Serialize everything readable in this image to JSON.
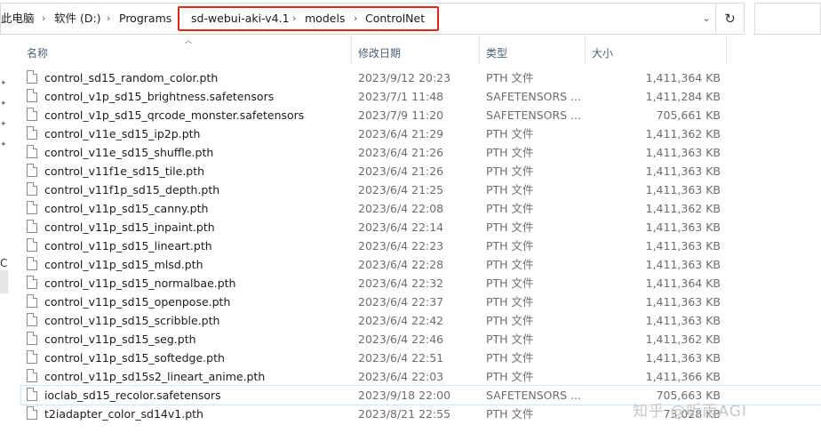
{
  "address_bar": {
    "crumbs": [
      "此电脑",
      "软件 (D:)",
      "Programs",
      "sd-webui-aki-v4.1",
      "models",
      "ControlNet"
    ]
  },
  "nav": {
    "partial_label": "C"
  },
  "columns": {
    "name": "名称",
    "modified": "修改日期",
    "type": "类型",
    "size": "大小"
  },
  "files": [
    {
      "name": "control_sd15_random_color.pth",
      "modified": "2023/9/12 20:23",
      "type": "PTH 文件",
      "size": "1,411,364 KB"
    },
    {
      "name": "control_v1p_sd15_brightness.safetensors",
      "modified": "2023/7/1 11:48",
      "type": "SAFETENSORS ...",
      "size": "1,411,284 KB"
    },
    {
      "name": "control_v1p_sd15_qrcode_monster.safetensors",
      "modified": "2023/7/9 11:20",
      "type": "SAFETENSORS ...",
      "size": "705,661 KB"
    },
    {
      "name": "control_v11e_sd15_ip2p.pth",
      "modified": "2023/6/4 21:29",
      "type": "PTH 文件",
      "size": "1,411,362 KB"
    },
    {
      "name": "control_v11e_sd15_shuffle.pth",
      "modified": "2023/6/4 21:26",
      "type": "PTH 文件",
      "size": "1,411,363 KB"
    },
    {
      "name": "control_v11f1e_sd15_tile.pth",
      "modified": "2023/6/4 21:26",
      "type": "PTH 文件",
      "size": "1,411,363 KB"
    },
    {
      "name": "control_v11f1p_sd15_depth.pth",
      "modified": "2023/6/4 21:25",
      "type": "PTH 文件",
      "size": "1,411,363 KB"
    },
    {
      "name": "control_v11p_sd15_canny.pth",
      "modified": "2023/6/4 22:08",
      "type": "PTH 文件",
      "size": "1,411,362 KB"
    },
    {
      "name": "control_v11p_sd15_inpaint.pth",
      "modified": "2023/6/4 22:14",
      "type": "PTH 文件",
      "size": "1,411,363 KB"
    },
    {
      "name": "control_v11p_sd15_lineart.pth",
      "modified": "2023/6/4 22:23",
      "type": "PTH 文件",
      "size": "1,411,363 KB"
    },
    {
      "name": "control_v11p_sd15_mlsd.pth",
      "modified": "2023/6/4 22:28",
      "type": "PTH 文件",
      "size": "1,411,363 KB"
    },
    {
      "name": "control_v11p_sd15_normalbae.pth",
      "modified": "2023/6/4 22:32",
      "type": "PTH 文件",
      "size": "1,411,364 KB"
    },
    {
      "name": "control_v11p_sd15_openpose.pth",
      "modified": "2023/6/4 22:37",
      "type": "PTH 文件",
      "size": "1,411,363 KB"
    },
    {
      "name": "control_v11p_sd15_scribble.pth",
      "modified": "2023/6/4 22:42",
      "type": "PTH 文件",
      "size": "1,411,363 KB"
    },
    {
      "name": "control_v11p_sd15_seg.pth",
      "modified": "2023/6/4 22:46",
      "type": "PTH 文件",
      "size": "1,411,362 KB"
    },
    {
      "name": "control_v11p_sd15_softedge.pth",
      "modified": "2023/6/4 22:51",
      "type": "PTH 文件",
      "size": "1,411,363 KB"
    },
    {
      "name": "control_v11p_sd15s2_lineart_anime.pth",
      "modified": "2023/6/4 22:03",
      "type": "PTH 文件",
      "size": "1,411,366 KB"
    },
    {
      "name": "ioclab_sd15_recolor.safetensors",
      "modified": "2023/9/18 22:00",
      "type": "SAFETENSORS ...",
      "size": "705,663 KB"
    },
    {
      "name": "t2iadapter_color_sd14v1.pth",
      "modified": "2023/8/21 22:55",
      "type": "PTH 文件",
      "size": "73,028 KB"
    }
  ],
  "selected_index": 17,
  "watermark": "知乎 @听雨AGI",
  "colors": {
    "highlight_box": "#e0261a",
    "header_text": "#4c607a",
    "selection_border": "#cce8ff"
  }
}
